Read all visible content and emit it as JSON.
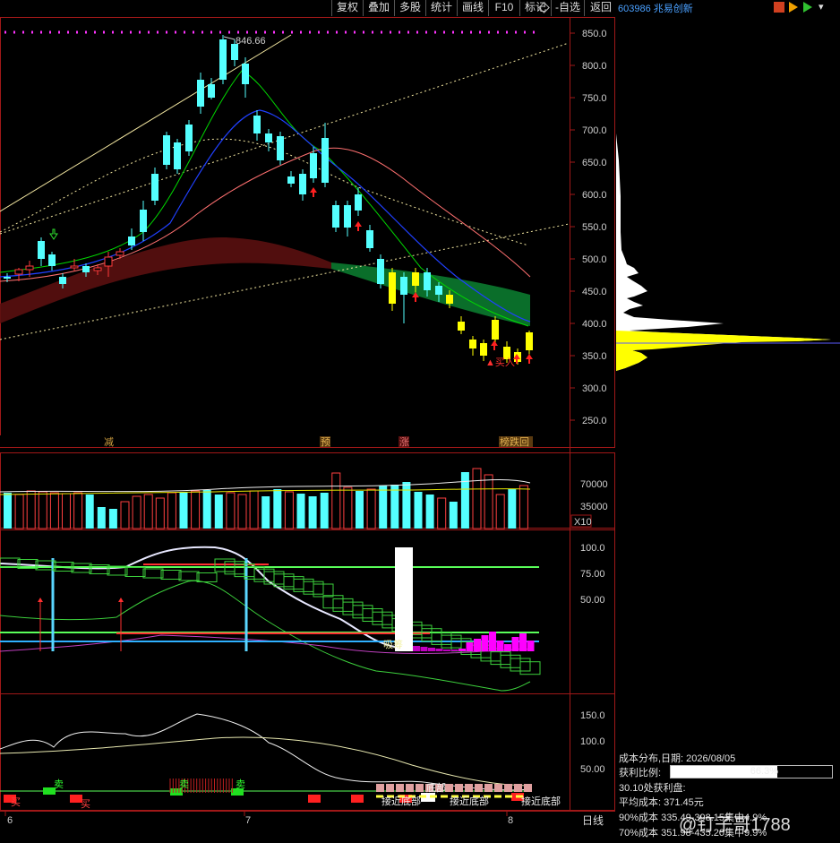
{
  "toolbar": {
    "buttons": [
      "复权",
      "叠加",
      "多股",
      "统计",
      "画线",
      "F10",
      "标记",
      "-自选",
      "返回"
    ]
  },
  "stock": {
    "code_name": "603986 兆易创新"
  },
  "price_axis": [
    "850.0",
    "800.0",
    "750.0",
    "700.0",
    "650.0",
    "600.0",
    "550.0",
    "500.0",
    "450.0",
    "400.0",
    "350.0",
    "300.0",
    "250.0"
  ],
  "max_label": "846.66",
  "signal_labels": {
    "jian": "减",
    "yu": "预",
    "zhang": "涨",
    "bangdie": "榜跌回",
    "buy": "▲买入"
  },
  "volume_axis": {
    "v70000": "70000",
    "v35000": "35000",
    "unit": "X10"
  },
  "ind1_axis": [
    "100.0",
    "75.00",
    "50.00"
  ],
  "ind1_label": "吸筹",
  "ind2_axis": [
    "150.0",
    "100.0",
    "50.00"
  ],
  "ind2_labels": {
    "mai_chu": "卖",
    "mai_ru": "买",
    "di_bu": "底部",
    "jie_jin_di_bu": "接近底部"
  },
  "date_axis": {
    "m6": "6",
    "m7": "7",
    "m8": "8"
  },
  "period_button": "日线",
  "side_info": {
    "title": "成本分布,日期: 2026/08/05",
    "profit_label": "获利比例:",
    "profit_value": "66.3%",
    "profit_fraction": 0.663,
    "line3": "30.10处获利盘:",
    "avg_cost": "平均成本: 371.45元",
    "line90": "90%成本 335.49-398.15集中4.9%",
    "line70": "70%成本 351.98-435.20集中9.9%"
  },
  "watermark": "@钉子哥1788",
  "colors": {
    "up": "#ff3b3b",
    "down": "#54ffff",
    "yellow": "#ffff00",
    "magenta": "#ff00ff",
    "green": "#00ff00"
  }
}
